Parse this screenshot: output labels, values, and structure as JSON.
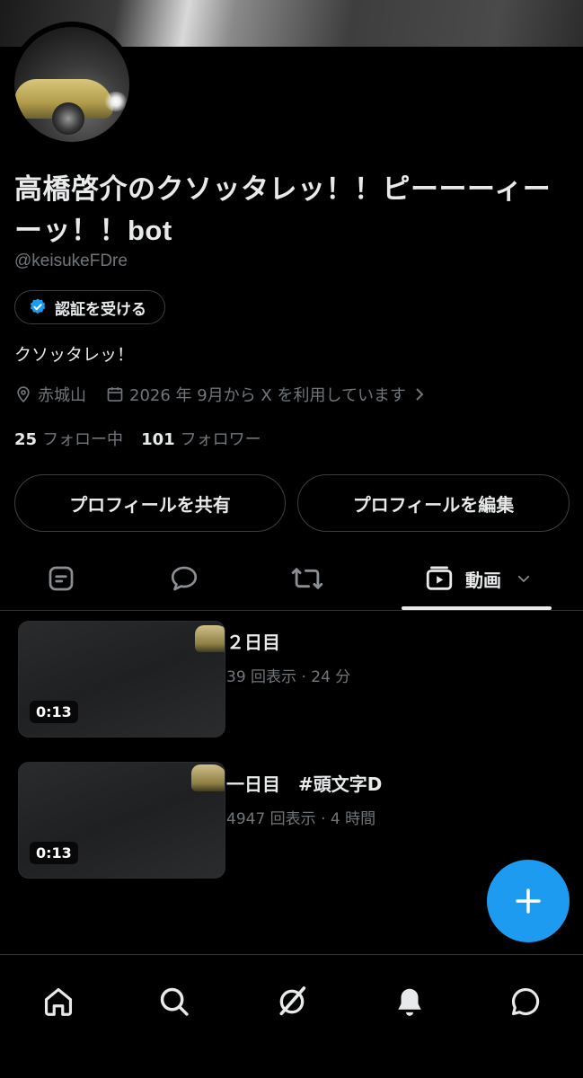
{
  "profile": {
    "display_name": "高橋啓介のクソッタレッ！！ピーーーィーーッ！！bot",
    "handle": "@keisukeFDre",
    "verify_label": "認証を受ける",
    "bio": "クソッタレッ！",
    "location": "赤城山",
    "joined": "2026 年 9月から X を利用しています",
    "following_count": "25",
    "following_label": "フォロー中",
    "followers_count": "101",
    "followers_label": "フォロワー"
  },
  "actions": {
    "share_label": "プロフィールを共有",
    "edit_label": "プロフィールを編集"
  },
  "tabs": {
    "active_label": "動画",
    "icons": [
      "posts-icon",
      "replies-icon",
      "reposts-icon",
      "video-icon"
    ]
  },
  "videos": [
    {
      "title": "２日目",
      "meta": "39 回表示 · 24 分",
      "duration": "0:13"
    },
    {
      "title": "一日目　#頭文字D",
      "meta": "4947 回表示 · 4 時間",
      "duration": "0:13"
    }
  ],
  "nav": [
    "home-icon",
    "search-icon",
    "grok-icon",
    "notifications-icon",
    "messages-icon"
  ],
  "colors": {
    "accent": "#1d9bf0",
    "background": "#000000",
    "muted": "#71767b",
    "text": "#e7e9ea"
  }
}
